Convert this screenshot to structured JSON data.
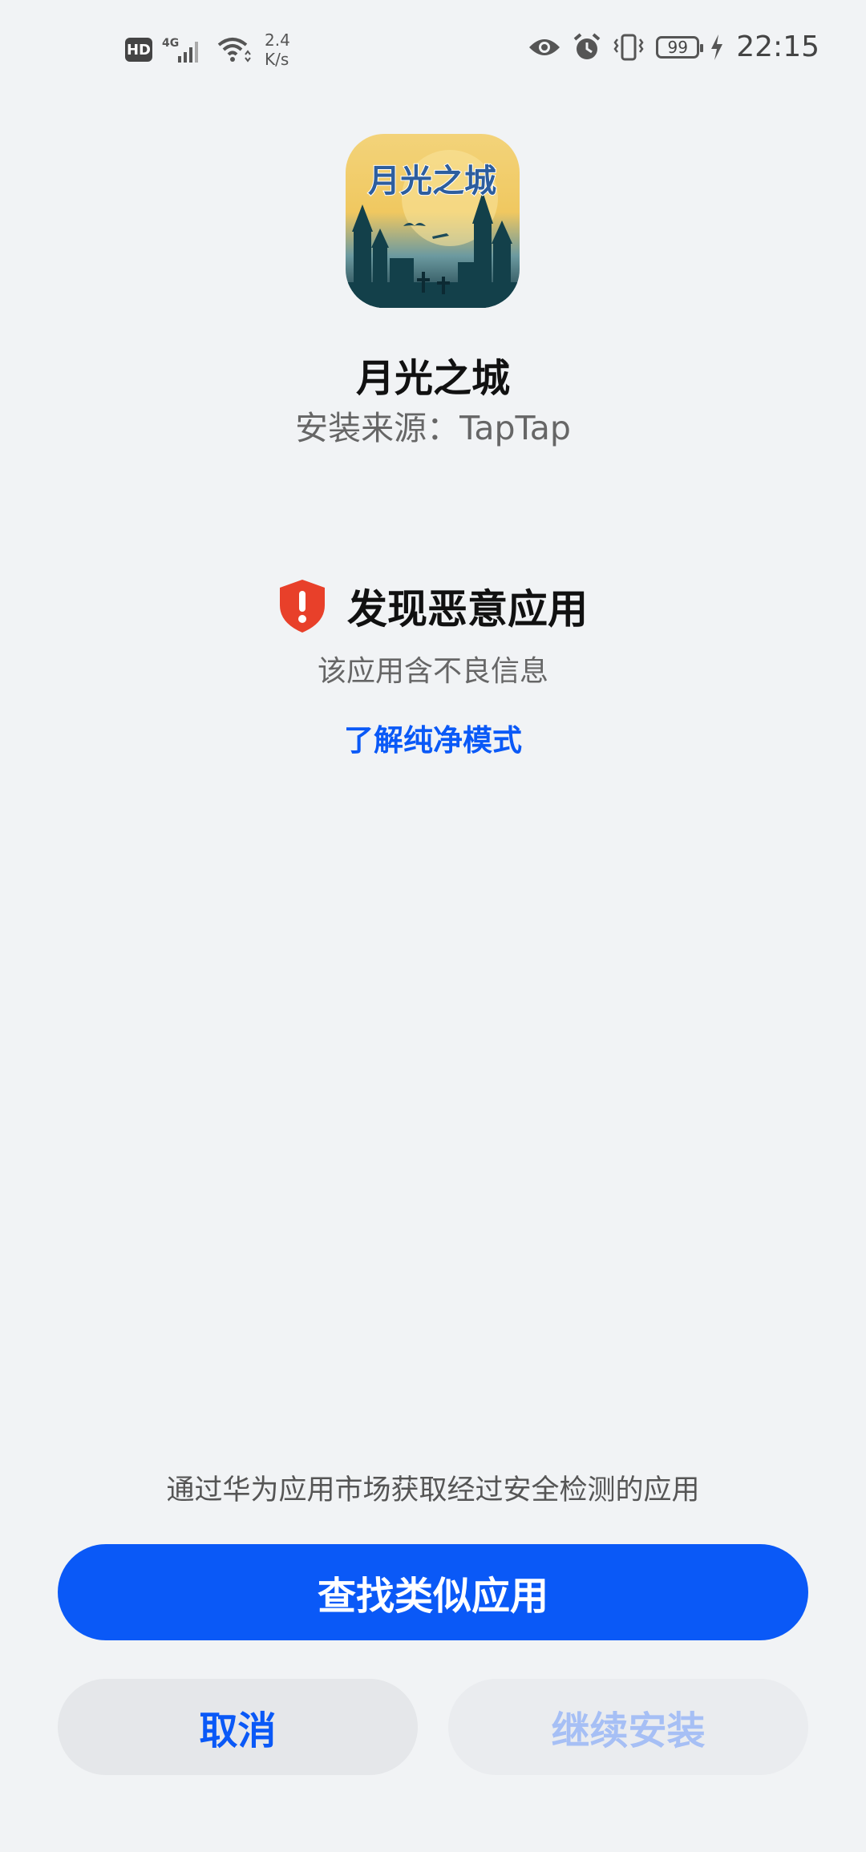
{
  "status_bar": {
    "hd": "HD",
    "network": "4G",
    "speed_value": "2.4",
    "speed_unit": "K/s",
    "battery": "99",
    "time": "22:15"
  },
  "app": {
    "name": "月光之城",
    "source": "安装来源：TapTap",
    "icon_text": "月光之城"
  },
  "warning": {
    "title": "发现恶意应用",
    "subtitle": "该应用含不良信息",
    "learn_link": "了解纯净模式",
    "color": "#e8402a"
  },
  "footer": {
    "market_note": "通过华为应用市场获取经过安全检测的应用",
    "find_similar": "查找类似应用",
    "cancel": "取消",
    "continue_install": "继续安装"
  },
  "colors": {
    "accent": "#0a59f7",
    "background": "#f1f3f5"
  }
}
